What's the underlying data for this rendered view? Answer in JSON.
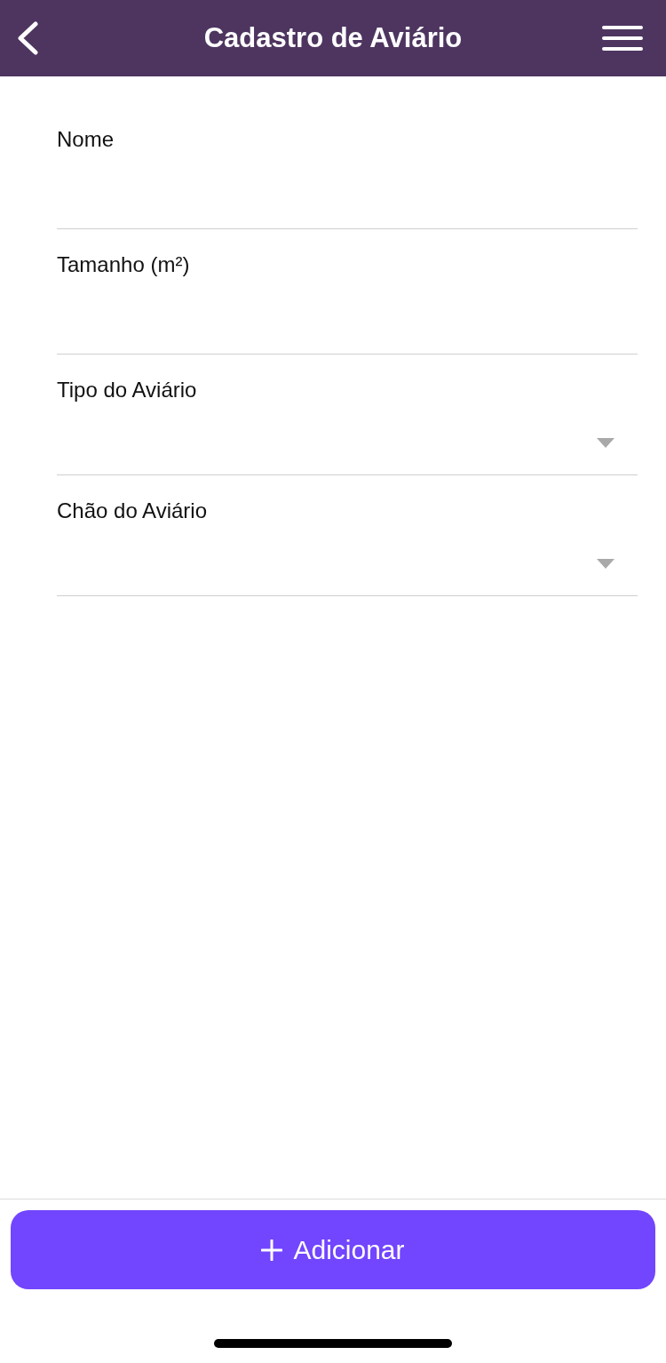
{
  "header": {
    "title": "Cadastro de Aviário"
  },
  "fields": [
    {
      "label": "Nome",
      "kind": "text"
    },
    {
      "label": "Tamanho (m²)",
      "kind": "text"
    },
    {
      "label": "Tipo do Aviário",
      "kind": "select"
    },
    {
      "label": "Chão do Aviário",
      "kind": "select"
    }
  ],
  "submit_button": {
    "label": "Adicionar"
  }
}
